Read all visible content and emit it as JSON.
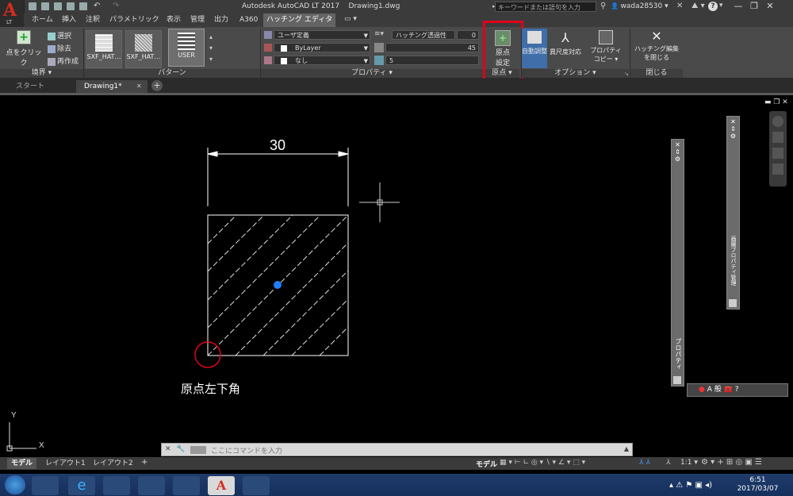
{
  "window": {
    "app_title": "Autodesk AutoCAD LT 2017",
    "document_title": "Drawing1.dwg",
    "app_badge": "LT",
    "search_placeholder": "キーワードまたは語句を入力",
    "user_name": "wada28530"
  },
  "ribbon_tabs": [
    {
      "label": "ホーム"
    },
    {
      "label": "挿入"
    },
    {
      "label": "注釈"
    },
    {
      "label": "パラメトリック"
    },
    {
      "label": "表示"
    },
    {
      "label": "管理"
    },
    {
      "label": "出力"
    },
    {
      "label": "A360"
    },
    {
      "label": "ハッチング エディタ"
    }
  ],
  "ribbon": {
    "boundary": {
      "pick_points": "点をクリック",
      "select": "選択",
      "remove": "除去",
      "recreate": "再作成",
      "title": "境界"
    },
    "pattern": {
      "items": [
        "SXF_HAT…",
        "SXF_HAT…",
        "USER"
      ],
      "title": "パターン"
    },
    "properties": {
      "hatch_type": "ユーザ定義",
      "transparency_label": "ハッチング透過性",
      "transparency_value": "0",
      "color": "ByLayer",
      "angle_value": "45",
      "background": "なし",
      "spacing_value": "5",
      "title": "プロパティ"
    },
    "origin": {
      "set_origin": "原点\n設定",
      "set_origin_line1": "原点",
      "set_origin_line2": "設定",
      "title": "原点"
    },
    "options": {
      "associative": "自動調整",
      "annotative": "異尺度対応",
      "match_prop_line1": "プロパティ",
      "match_prop_line2": "コピー",
      "title": "オプション"
    },
    "close": {
      "label_line1": "ハッチング編集",
      "label_line2": "を閉じる",
      "title": "閉じる"
    }
  },
  "doc_tabs": [
    {
      "label": "スタート"
    },
    {
      "label": "Drawing1*"
    }
  ],
  "drawing": {
    "dimension_value": "30",
    "annotation": "原点左下角"
  },
  "palettes": {
    "properties_title": "プロパティ",
    "layer_title": "画層プロパティ管理"
  },
  "command_line": {
    "placeholder": "ここにコマンドを入力"
  },
  "layout_tabs": [
    {
      "label": "モデル"
    },
    {
      "label": "レイアウト1"
    },
    {
      "label": "レイアウト2"
    }
  ],
  "status_bar": {
    "model_label": "モデル",
    "scale": "1:1"
  },
  "ime": {
    "mode": "A 般"
  },
  "taskbar": {
    "time": "6:51",
    "date": "2017/03/07"
  },
  "colors": {
    "highlight": "#e0001b",
    "hatch_grip": "#1f7fff",
    "accent": "#d52b1e"
  }
}
